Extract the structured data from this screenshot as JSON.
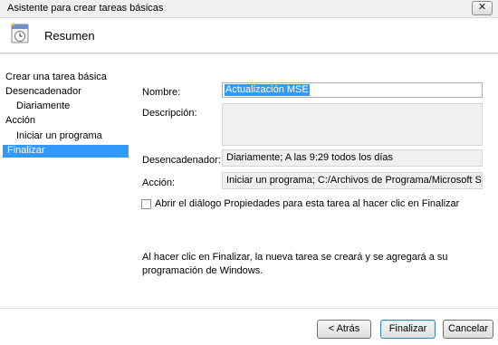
{
  "window": {
    "title": "Asistente para crear tareas básicas",
    "close_glyph": "✕"
  },
  "header": {
    "title": "Resumen",
    "icon": "task-wizard-icon"
  },
  "sidebar": {
    "items": [
      {
        "label": "Crear una tarea básica",
        "level": 0,
        "selected": false
      },
      {
        "label": "Desencadenador",
        "level": 0,
        "selected": false
      },
      {
        "label": "Diariamente",
        "level": 1,
        "selected": false
      },
      {
        "label": "Acción",
        "level": 0,
        "selected": false
      },
      {
        "label": "Iniciar un programa",
        "level": 1,
        "selected": false
      },
      {
        "label": "Finalizar",
        "level": 0,
        "selected": true
      }
    ]
  },
  "form": {
    "name_label": "Nombre:",
    "name_value": "Actualización MSE",
    "description_label": "Descripción:",
    "description_value": "",
    "trigger_label": "Desencadenador:",
    "trigger_value": "Diariamente; A las 9:29 todos los días",
    "action_label": "Acción:",
    "action_value": "Iniciar un programa; C:/Archivos de Programa/Microsoft Security Ess",
    "open_properties_label": "Abrir el diálogo Propiedades para esta tarea al hacer clic en Finalizar",
    "open_properties_checked": false
  },
  "info_text": "Al hacer clic en Finalizar, la nueva tarea se creará y se agregará a su programación de Windows.",
  "buttons": {
    "back": "< Atrás",
    "finish": "Finalizar",
    "cancel": "Cancelar"
  },
  "colors": {
    "selection": "#3399ff",
    "readonly_field": "#f0f0f0"
  }
}
